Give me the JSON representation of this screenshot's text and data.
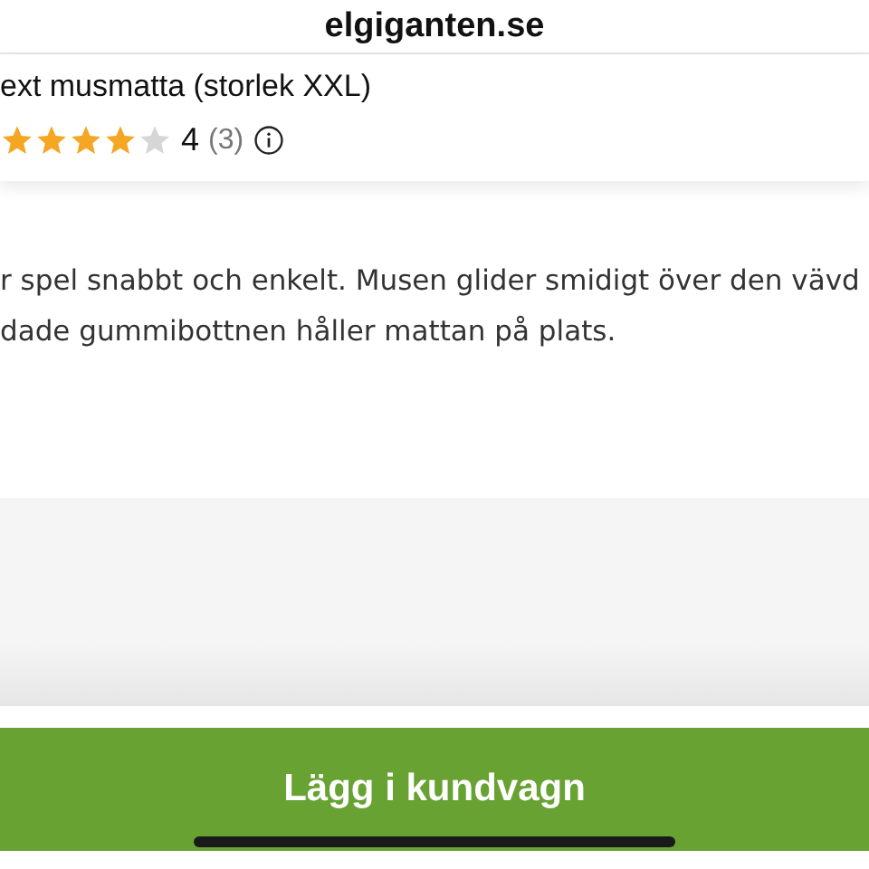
{
  "browser": {
    "address": "elgiganten.se"
  },
  "product": {
    "title": "ext musmatta (storlek XXL)",
    "stars": 4,
    "rating": "4",
    "review_count": "(3)"
  },
  "description": [
    "r spel snabbt och enkelt. Musen glider smidigt över den vävd",
    "dade gummibottnen håller mattan på plats."
  ],
  "add_to_cart_button": "Lägg i kundvagn"
}
